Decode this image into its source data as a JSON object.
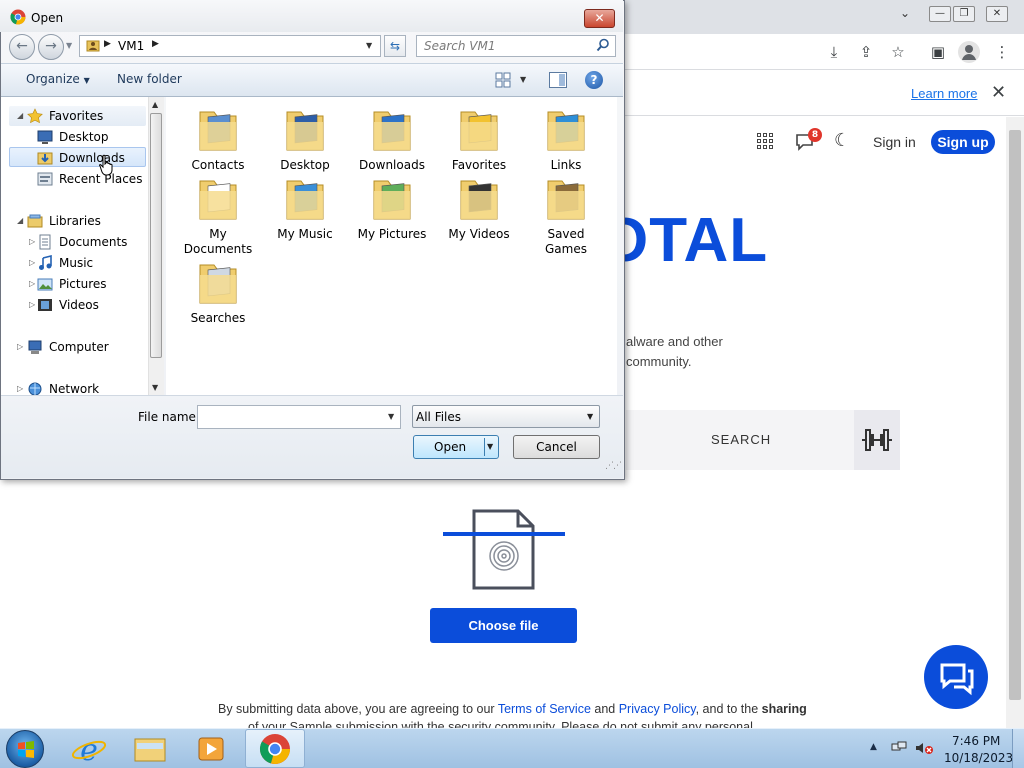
{
  "browser": {
    "infobar": {
      "learn_more": "Learn more"
    },
    "header": {
      "notification_count": "8",
      "sign_in": "Sign in",
      "sign_up": "Sign up"
    },
    "hero": {
      "logo_fragment": "OTAL"
    },
    "description": {
      "line1": "alware and other",
      "line2": "community."
    },
    "search_tab": {
      "label": "SEARCH"
    },
    "upload": {
      "choose_file": "Choose file"
    },
    "terms": {
      "prefix": "By submitting data above, you are agreeing to our ",
      "tos": "Terms of Service",
      "and": " and ",
      "privacy": "Privacy Policy",
      "suffix": ", and to the ",
      "sharing": "sharing",
      "line2": "of your Sample submission with the security community. Please do not submit any personal"
    },
    "colors": {
      "brand": "#0b4dda",
      "badge": "#e0352b"
    }
  },
  "dialog": {
    "title": "Open",
    "address": {
      "path": "VM1"
    },
    "search": {
      "placeholder": "Search VM1"
    },
    "toolbar": {
      "organize": "Organize",
      "new_folder": "New folder",
      "help": "?"
    },
    "nav": {
      "favorites": "Favorites",
      "desktop": "Desktop",
      "downloads": "Downloads",
      "recent_places": "Recent Places",
      "libraries": "Libraries",
      "documents": "Documents",
      "music": "Music",
      "pictures": "Pictures",
      "videos": "Videos",
      "computer": "Computer",
      "network": "Network"
    },
    "files": [
      {
        "name": "Contacts",
        "icon": "contacts-folder-icon"
      },
      {
        "name": "Desktop",
        "icon": "desktop-folder-icon"
      },
      {
        "name": "Downloads",
        "icon": "downloads-folder-icon"
      },
      {
        "name": "Favorites",
        "icon": "favorites-folder-icon"
      },
      {
        "name": "Links",
        "icon": "links-folder-icon"
      },
      {
        "name": "My\nDocuments",
        "icon": "documents-folder-icon"
      },
      {
        "name": "My Music",
        "icon": "music-folder-icon"
      },
      {
        "name": "My Pictures",
        "icon": "pictures-folder-icon"
      },
      {
        "name": "My Videos",
        "icon": "videos-folder-icon"
      },
      {
        "name": "Saved\nGames",
        "icon": "saved-games-folder-icon"
      },
      {
        "name": "Searches",
        "icon": "searches-folder-icon"
      }
    ],
    "bottom": {
      "file_name_label": "File name:",
      "file_name_value": "",
      "filter": "All Files",
      "open": "Open",
      "cancel": "Cancel"
    }
  },
  "taskbar": {
    "time": "7:46 PM",
    "date": "10/18/2023"
  }
}
